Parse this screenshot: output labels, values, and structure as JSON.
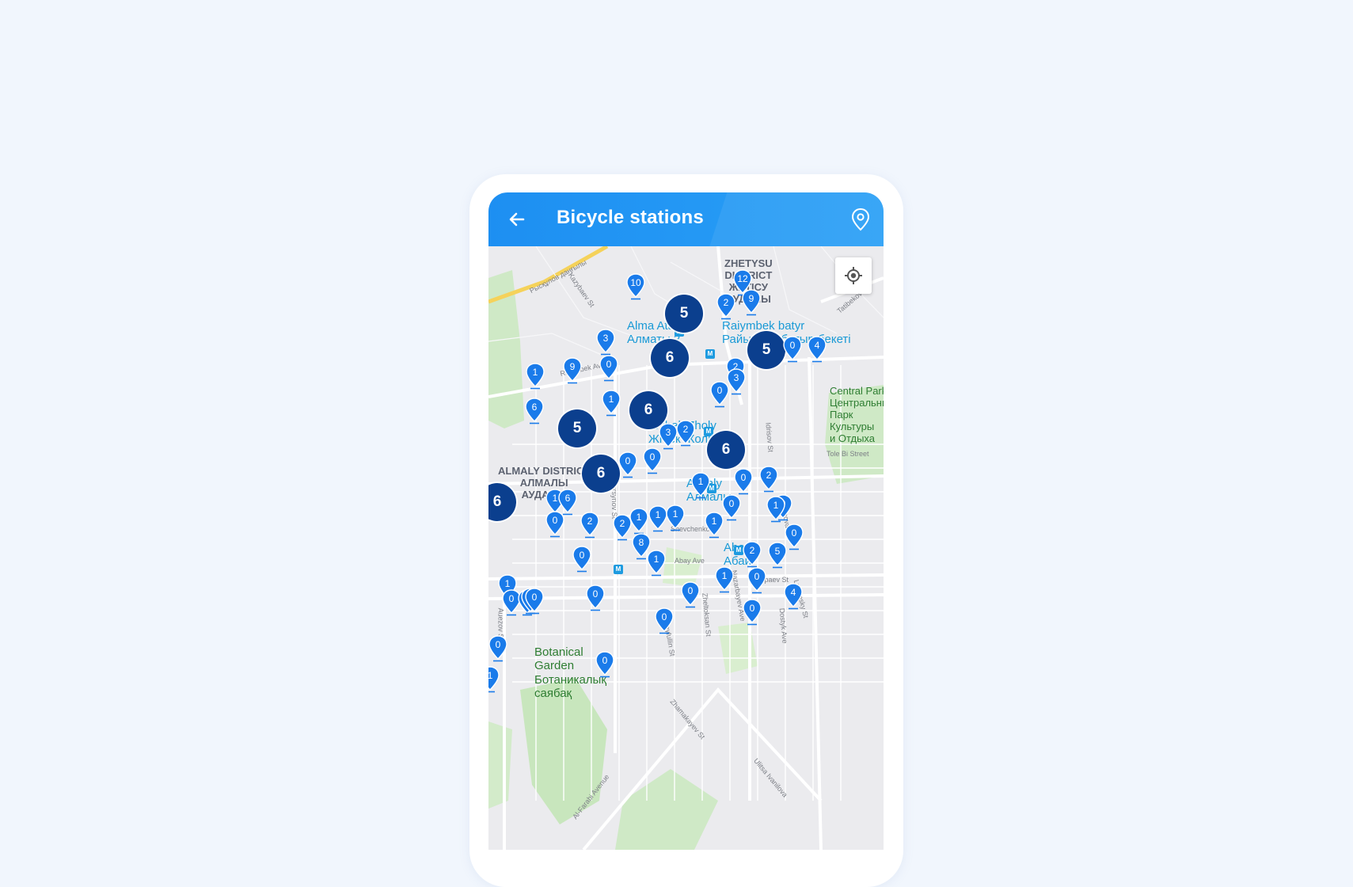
{
  "header": {
    "title": "Bicycle stations",
    "back_icon": "arrow-left-icon",
    "location_icon": "map-pin-outline-icon",
    "gradient_colors": [
      "#1d8ff2",
      "#2aa0f6"
    ]
  },
  "map": {
    "locate_icon": "gps-crosshair-icon",
    "districts": [
      "ZHETYSU\nDISTRICT\nЖЕТІСУ\nАУДАНЫ",
      "ALMALY DISTRICT\nАЛМАЛЫ\nАУДАНЫ"
    ],
    "stations": [
      "Alma Ata 2\nАлматы 2",
      "Raiymbek batyr\nРайымбек батыр бекеті",
      "Zhibek Zholy\nЖібек Жолы",
      "Almaly\nАлмалы",
      "Abay\nАбай"
    ],
    "parks": [
      "Central Park\nЦентральный\nПарк\nКультуры\nи Отдыха",
      "Botanical\nGarden\nБотаникалық\nсаябақ"
    ],
    "streets": [
      "Рысқұлов даңғылы",
      "Kazybaev St",
      "Raiymbek Ave",
      "Tatibekov St",
      "Tole Bi Street",
      "Baitursynov St",
      "Shevchenko St",
      "Abay Ave",
      "Satpaev St",
      "Auezov St",
      "Seyfullin St",
      "Zheltoksan St",
      "Nazarbayev Ave",
      "Dostyk Ave",
      "Zhamakayev St",
      "Al-Farabi Avenue",
      "Ulitsa Ivanilova",
      "Lugansky St",
      "Kaminova St",
      "Idrisov St"
    ],
    "clusters": [
      5,
      6,
      5,
      6,
      5,
      6,
      6,
      6
    ],
    "pins": [
      10,
      12,
      2,
      9,
      3,
      0,
      4,
      1,
      9,
      0,
      2,
      3,
      0,
      1,
      6,
      3,
      2,
      0,
      0,
      1,
      0,
      2,
      1,
      6,
      0,
      0,
      1,
      2,
      2,
      1,
      1,
      1,
      0,
      8,
      1,
      0,
      1,
      2,
      5,
      1,
      0,
      0,
      0,
      0,
      4,
      1,
      0,
      0,
      5,
      0,
      0,
      0,
      0,
      0,
      1
    ]
  },
  "colors": {
    "background": "#f1f6fd",
    "pin": "#1a7bea",
    "cluster": "#0b3f8e",
    "metro": "#1e9be0"
  }
}
